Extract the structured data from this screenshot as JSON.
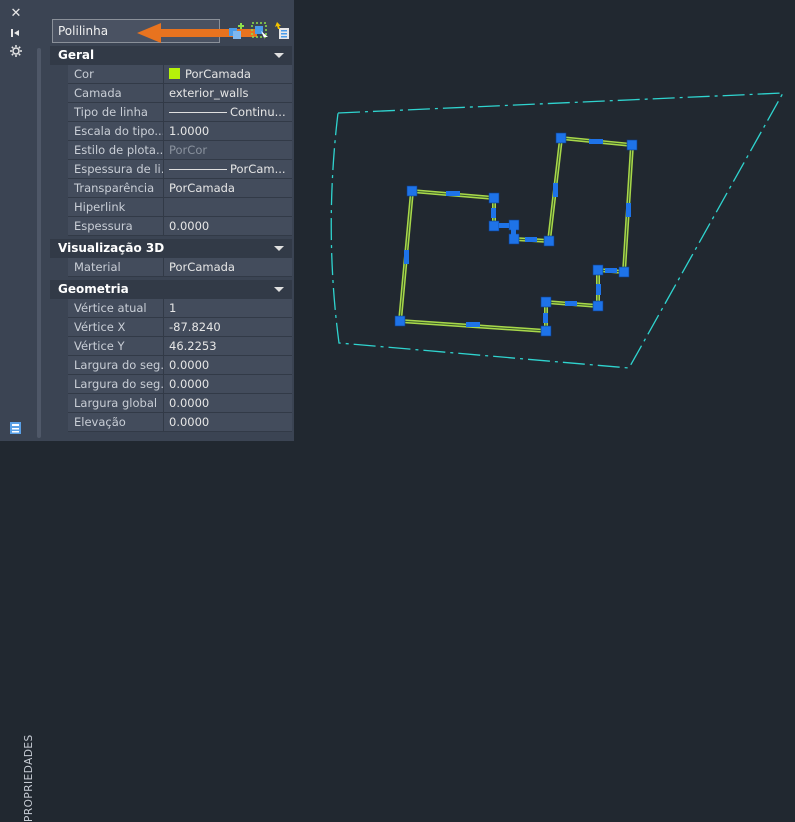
{
  "strip": {
    "title": "PROPRIEDADES",
    "close_icon": "close-icon",
    "autohide_icon": "autohide-icon",
    "settings_icon": "gear-icon"
  },
  "selector": {
    "value": "Polilinha"
  },
  "toolbar": {
    "icons": [
      "toggle-pickadd-icon",
      "select-objects-icon",
      "quick-select-icon"
    ]
  },
  "colors": {
    "panel_bg": "#3b4453",
    "section_bg": "#323a47",
    "canvas_bg": "#212830",
    "annotation_arrow": "#e8731f",
    "polyline": "#a8d84a",
    "grip": "#1e73e8",
    "boundary": "#2fd4cf",
    "color_swatch": "#b6f20a"
  },
  "sections": [
    {
      "title": "Geral",
      "rows": [
        {
          "name": "Cor",
          "value": "PorCamada"
        },
        {
          "name": "Camada",
          "value": "exterior_walls"
        },
        {
          "name": "Tipo de linha",
          "value": "Continu..."
        },
        {
          "name": "Escala do tipo...",
          "value": "1.0000"
        },
        {
          "name": "Estilo de plota...",
          "value": "PorCor"
        },
        {
          "name": "Espessura de li...",
          "value": "PorCam..."
        },
        {
          "name": "Transparência",
          "value": "PorCamada"
        },
        {
          "name": "Hiperlink",
          "value": ""
        },
        {
          "name": "Espessura",
          "value": "0.0000"
        }
      ]
    },
    {
      "title": "Visualização 3D",
      "rows": [
        {
          "name": "Material",
          "value": "PorCamada"
        }
      ]
    },
    {
      "title": "Geometria",
      "rows": [
        {
          "name": "Vértice atual",
          "value": "1"
        },
        {
          "name": "Vértice X",
          "value": "-87.8240"
        },
        {
          "name": "Vértice Y",
          "value": "46.2253"
        },
        {
          "name": "Largura do seg...",
          "value": "0.0000"
        },
        {
          "name": "Largura do seg...",
          "value": "0.0000"
        },
        {
          "name": "Largura global",
          "value": "0.0000"
        },
        {
          "name": "Elevação",
          "value": "0.0000"
        }
      ]
    }
  ]
}
